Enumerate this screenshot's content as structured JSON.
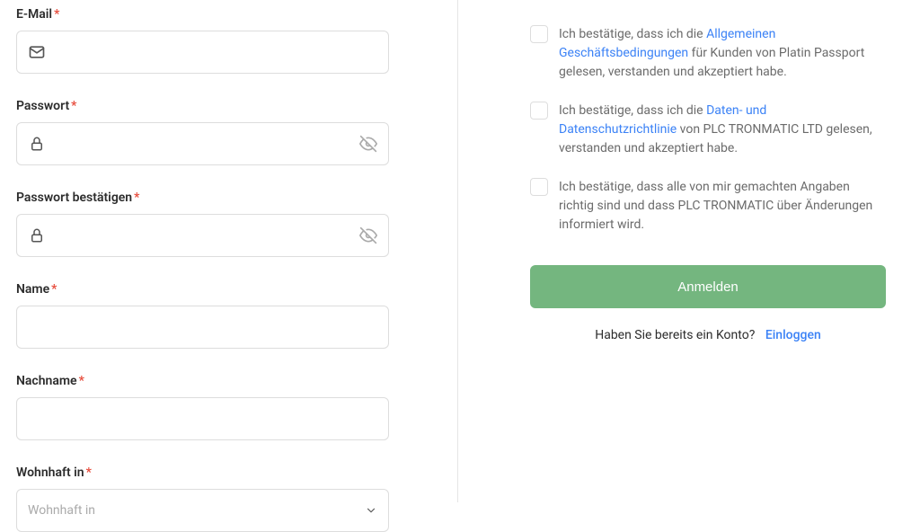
{
  "form": {
    "email": {
      "label": "E-Mail",
      "value": ""
    },
    "password": {
      "label": "Passwort",
      "value": ""
    },
    "password_confirm": {
      "label": "Passwort bestätigen",
      "value": ""
    },
    "first_name": {
      "label": "Name",
      "value": ""
    },
    "last_name": {
      "label": "Nachname",
      "value": ""
    },
    "residence": {
      "label": "Wohnhaft in",
      "placeholder": "Wohnhaft in"
    }
  },
  "confirmations": {
    "terms": {
      "prefix": "Ich bestätige, dass ich die ",
      "link": "Allgemeinen Geschäftsbedingungen",
      "suffix": " für Kunden von Platin Passport gelesen, verstanden und akzeptiert habe."
    },
    "privacy": {
      "prefix": "Ich bestätige, dass ich die ",
      "link": "Daten- und Datenschutzrichtlinie",
      "suffix": " von PLC TRONMATIC LTD gelesen, verstanden und akzeptiert habe."
    },
    "accuracy": {
      "text": "Ich bestätige, dass alle von mir gemachten Angaben richtig sind und dass PLC TRONMATIC über Änderungen informiert wird."
    }
  },
  "submit_label": "Anmelden",
  "login_prompt": "Haben Sie bereits ein Konto?",
  "login_link": "Einloggen"
}
